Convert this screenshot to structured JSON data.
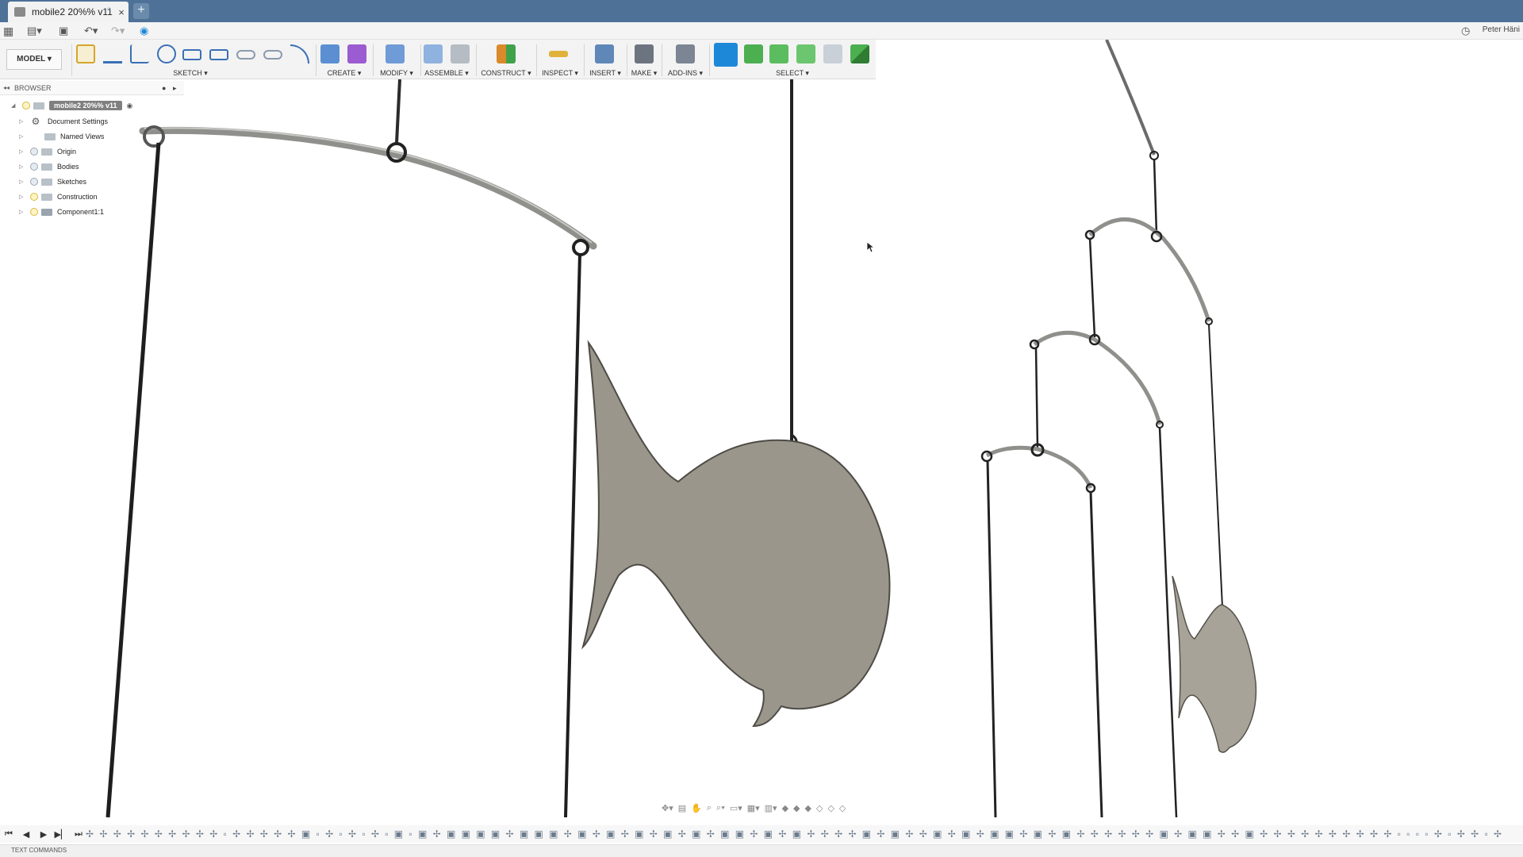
{
  "window": {
    "tab_title": "mobile2 20%% v11",
    "close_glyph": "×",
    "new_tab_glyph": "+",
    "user_name": "Peter Häni"
  },
  "toolbar": {
    "workspace": "MODEL ▾",
    "groups": [
      {
        "label": "SKETCH ▾"
      },
      {
        "label": "CREATE ▾"
      },
      {
        "label": "MODIFY ▾"
      },
      {
        "label": "ASSEMBLE ▾"
      },
      {
        "label": "CONSTRUCT ▾"
      },
      {
        "label": "INSPECT ▾"
      },
      {
        "label": "INSERT ▾"
      },
      {
        "label": "MAKE ▾"
      },
      {
        "label": "ADD-INS ▾"
      },
      {
        "label": "SELECT ▾"
      }
    ]
  },
  "browser": {
    "title": "BROWSER",
    "root": "mobile2 20%% v11",
    "items": [
      {
        "label": "Document Settings",
        "icon": "gear-icon"
      },
      {
        "label": "Named Views",
        "icon": "folder-icon"
      },
      {
        "label": "Origin",
        "icon": "folder-icon"
      },
      {
        "label": "Bodies",
        "icon": "folder-icon"
      },
      {
        "label": "Sketches",
        "icon": "folder-icon"
      },
      {
        "label": "Construction",
        "icon": "folder-icon"
      },
      {
        "label": "Component1:1",
        "icon": "component-icon"
      }
    ]
  },
  "footer": {
    "text_commands": "TEXT COMMANDS"
  },
  "colors": {
    "titlebar": "#4e7197",
    "accent": "#1e88d8",
    "fish": "#9a968c",
    "rod": "#8f8f8c",
    "string": "#2b2b2b"
  }
}
